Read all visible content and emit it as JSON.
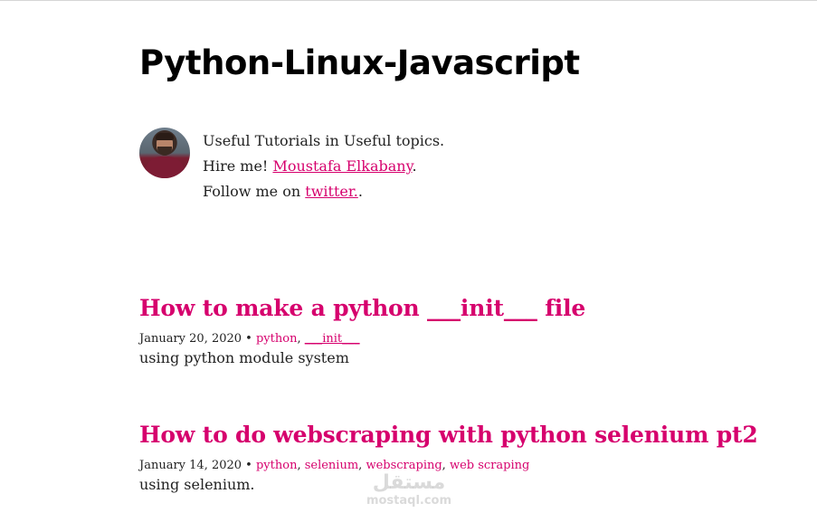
{
  "site": {
    "title": "Python-Linux-Javascript"
  },
  "bio": {
    "line1": "Useful Tutorials in Useful topics.",
    "line2_prefix": "Hire me! ",
    "author_link": "Moustafa Elkabany",
    "line2_suffix": ".",
    "line3_prefix": "Follow me on ",
    "twitter_link": "twitter.",
    "line3_suffix": "."
  },
  "posts": [
    {
      "title": "How to make a python ___init___ file",
      "date": "January 20, 2020",
      "separator": " • ",
      "tags": [
        "python",
        "___init___"
      ],
      "excerpt": "using python module system"
    },
    {
      "title": "How to do webscraping with python selenium pt2",
      "date": "January 14, 2020",
      "separator": " • ",
      "tags": [
        "python",
        "selenium",
        "webscraping",
        "web scraping"
      ],
      "excerpt": "using selenium."
    }
  ],
  "watermark": {
    "logo": "مستقل",
    "text": "mostaql.com"
  },
  "colors": {
    "accent": "#d6006d",
    "text": "#222222",
    "title": "#000000"
  }
}
